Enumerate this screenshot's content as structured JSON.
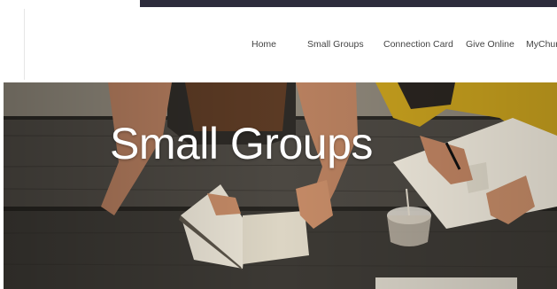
{
  "nav": {
    "items": [
      {
        "label": "Home"
      },
      {
        "label": "Small Groups"
      },
      {
        "label": "Connection Card"
      },
      {
        "label": "Give Online"
      },
      {
        "label": "MyChur"
      }
    ]
  },
  "hero": {
    "title": "Small Groups"
  },
  "colors": {
    "top_strip": "#2d2c3c",
    "nav_text": "#444444",
    "hero_title": "#ffffff"
  }
}
